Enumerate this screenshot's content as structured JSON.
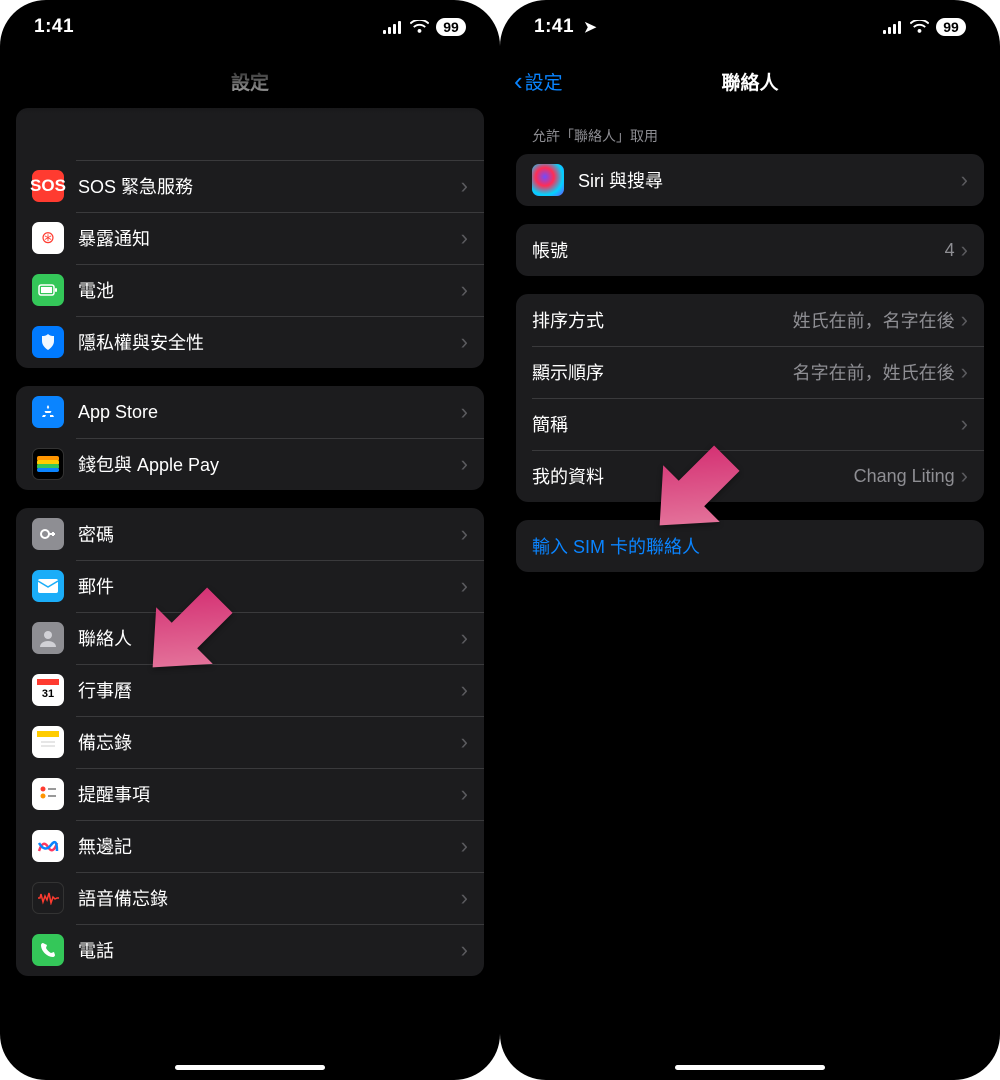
{
  "left": {
    "status": {
      "time": "1:41",
      "battery": "99"
    },
    "title": "設定",
    "group1": [
      {
        "icon": "sos",
        "label": "SOS 緊急服務"
      },
      {
        "icon": "exp",
        "label": "暴露通知"
      },
      {
        "icon": "bat",
        "label": "電池"
      },
      {
        "icon": "priv",
        "label": "隱私權與安全性"
      }
    ],
    "group2": [
      {
        "icon": "as",
        "label": "App Store"
      },
      {
        "icon": "wal",
        "label": "錢包與 Apple Pay"
      }
    ],
    "group3": [
      {
        "icon": "pwd",
        "label": "密碼"
      },
      {
        "icon": "mail",
        "label": "郵件"
      },
      {
        "icon": "cont",
        "label": "聯絡人"
      },
      {
        "icon": "cal",
        "label": "行事曆"
      },
      {
        "icon": "note",
        "label": "備忘錄"
      },
      {
        "icon": "rem",
        "label": "提醒事項"
      },
      {
        "icon": "free",
        "label": "無邊記"
      },
      {
        "icon": "voice",
        "label": "語音備忘錄"
      },
      {
        "icon": "phone",
        "label": "電話"
      }
    ]
  },
  "right": {
    "status": {
      "time": "1:41",
      "battery": "99"
    },
    "back_label": "設定",
    "title": "聯絡人",
    "section_allow": "允許「聯絡人」取用",
    "siri_row": {
      "label": "Siri 與搜尋"
    },
    "accounts": {
      "label": "帳號",
      "value": "4"
    },
    "sort": {
      "label": "排序方式",
      "value": "姓氏在前，名字在後"
    },
    "display": {
      "label": "顯示順序",
      "value": "名字在前，姓氏在後"
    },
    "short": {
      "label": "簡稱"
    },
    "mine": {
      "label": "我的資料",
      "value": "Chang Liting"
    },
    "import_sim": "輸入 SIM 卡的聯絡人"
  }
}
